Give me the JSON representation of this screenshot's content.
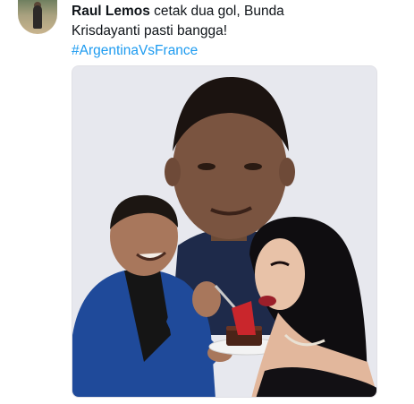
{
  "tweet": {
    "author_mention": "Raul Lemos",
    "text_line1_rest": " cetak dua gol, Bunda",
    "text_line2": "Krisdayanti pasti bangga!",
    "hashtag": "#ArgentinaVsFrance"
  },
  "media": {
    "description_icon": "photo-meme-image"
  },
  "colors": {
    "text": "#0f1419",
    "hashtag": "#1d9bf0",
    "background": "#ffffff"
  }
}
